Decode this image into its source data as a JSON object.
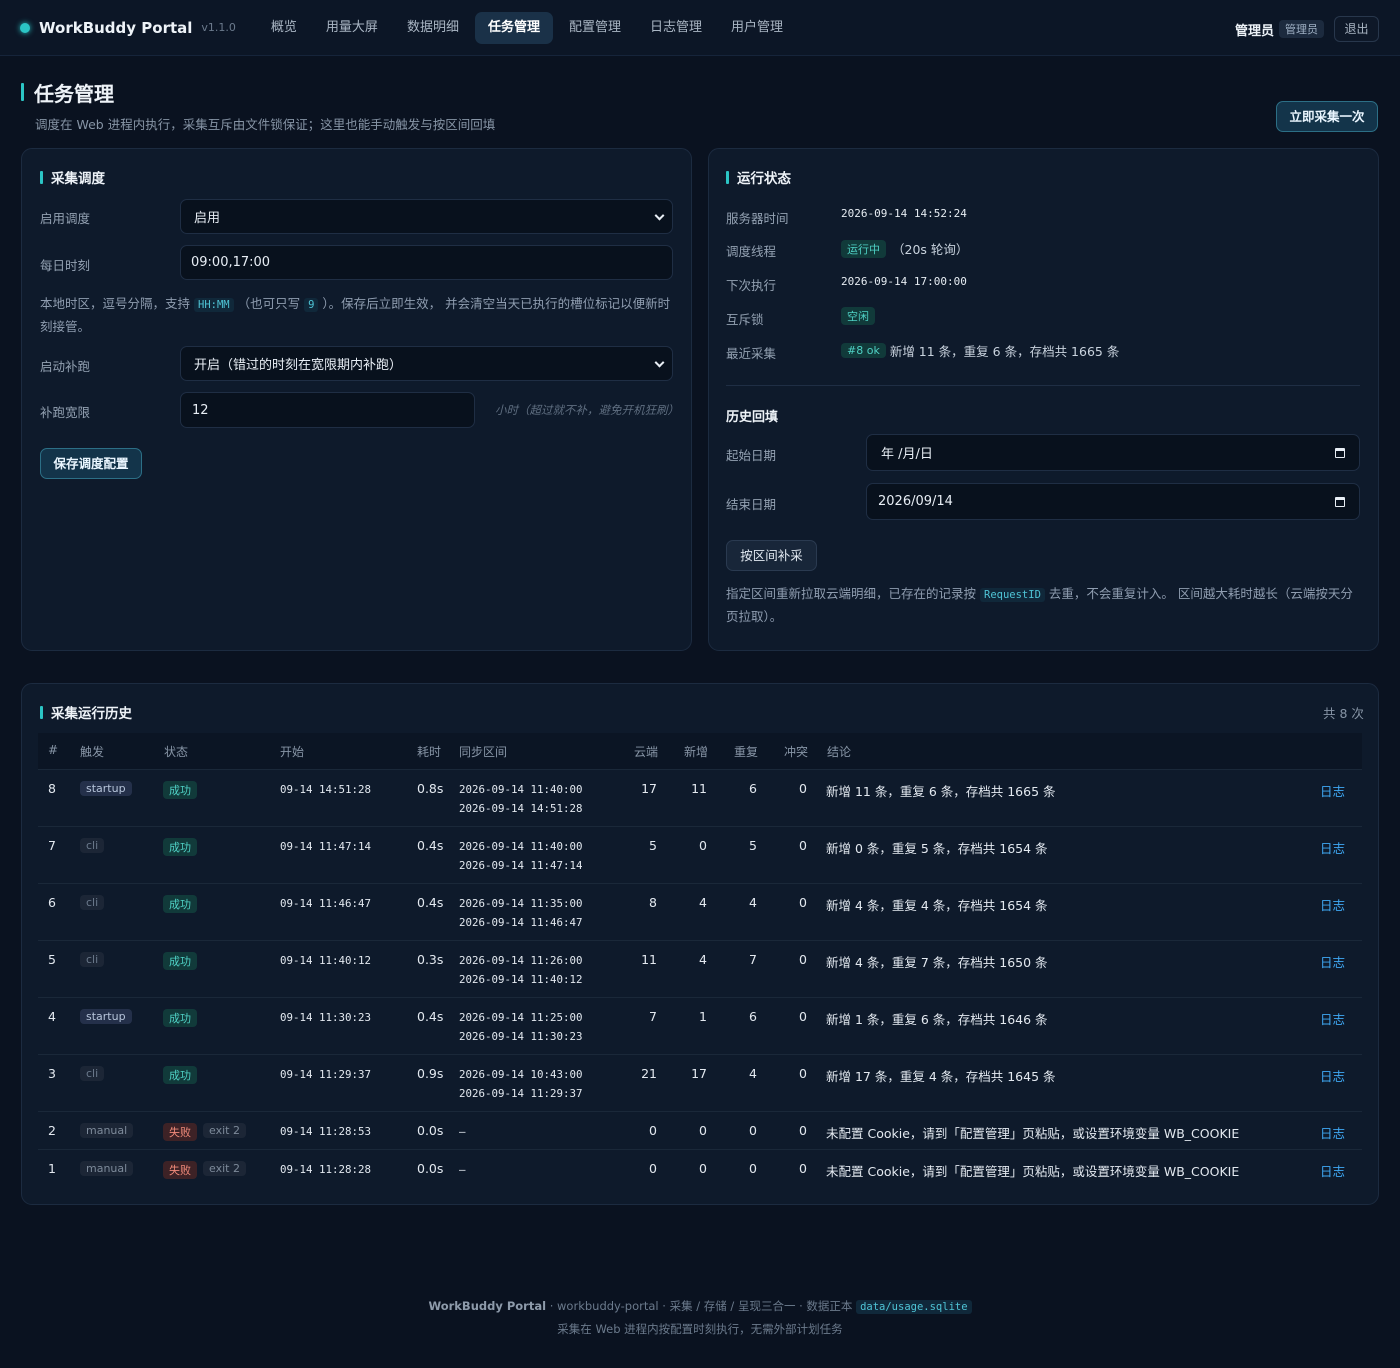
{
  "app": {
    "name": "WorkBuddy Portal",
    "version": "v1.1.0"
  },
  "nav": [
    "概览",
    "用量大屏",
    "数据明细",
    "任务管理",
    "配置管理",
    "日志管理",
    "用户管理"
  ],
  "user": {
    "name": "管理员",
    "role": "管理员",
    "logout": "退出"
  },
  "page": {
    "title": "任务管理",
    "subtitle": "调度在 Web 进程内执行，采集互斥由文件锁保证；这里也能手动触发与按区间回填",
    "collect_now": "立即采集一次"
  },
  "schedule": {
    "title": "采集调度",
    "enable_label": "启用调度",
    "enable_value": "启用",
    "times_label": "每日时刻",
    "times_value": "09:00,17:00",
    "hint_a": "本地时区，逗号分隔，支持",
    "hint_code1": "HH:MM",
    "hint_b": "（也可只写",
    "hint_code2": "9",
    "hint_c": "）。保存后立即生效， 并会清空当天已执行的槽位标记以便新时刻接管。",
    "catchup_label": "启动补跑",
    "catchup_value": "开启（错过的时刻在宽限期内补跑）",
    "grace_label": "补跑宽限",
    "grace_value": "12",
    "grace_unit": "小时（超过就不补，避免开机狂刷）",
    "save": "保存调度配置"
  },
  "status": {
    "title": "运行状态",
    "server_time_label": "服务器时间",
    "server_time": "2026-09-14 14:52:24",
    "thread_label": "调度线程",
    "thread_badge": "运行中",
    "thread_note": "（20s 轮询）",
    "next_label": "下次执行",
    "next_value": "2026-09-14 17:00:00",
    "lock_label": "互斥锁",
    "lock_badge": "空闲",
    "last_label": "最近采集",
    "last_badge": "#8 ok",
    "last_text": "新增 11 条，重复 6 条，存档共 1665 条"
  },
  "backfill": {
    "title": "历史回填",
    "start_label": "起始日期",
    "start_value": "年 /月/日",
    "end_label": "结束日期",
    "end_value": "2026/09/14",
    "button": "按区间补采",
    "hint_a": "指定区间重新拉取云端明细，已存在的记录按",
    "hint_code": "RequestID",
    "hint_b": "去重，不会重复计入。 区间越大耗时越长（云端按天分页拉取）。"
  },
  "history": {
    "title": "采集运行历史",
    "count": "共 8 次",
    "columns": [
      "#",
      "触发",
      "状态",
      "开始",
      "耗时",
      "同步区间",
      "云端",
      "新增",
      "重复",
      "冲突",
      "结论"
    ],
    "rows": [
      {
        "id": "8",
        "trigger": "startup",
        "status": "成功",
        "exit": "",
        "start": "09-14 14:51:28",
        "dur": "0.8s",
        "range1": "2026-09-14 11:40:00",
        "range2": "2026-09-14 14:51:28",
        "cloud": "17",
        "new": "11",
        "dup": "6",
        "conflict": "0",
        "result": "新增 11 条，重复 6 条，存档共 1665 条",
        "link": "日志"
      },
      {
        "id": "7",
        "trigger": "cli",
        "status": "成功",
        "exit": "",
        "start": "09-14 11:47:14",
        "dur": "0.4s",
        "range1": "2026-09-14 11:40:00",
        "range2": "2026-09-14 11:47:14",
        "cloud": "5",
        "new": "0",
        "dup": "5",
        "conflict": "0",
        "result": "新增 0 条，重复 5 条，存档共 1654 条",
        "link": "日志"
      },
      {
        "id": "6",
        "trigger": "cli",
        "status": "成功",
        "exit": "",
        "start": "09-14 11:46:47",
        "dur": "0.4s",
        "range1": "2026-09-14 11:35:00",
        "range2": "2026-09-14 11:46:47",
        "cloud": "8",
        "new": "4",
        "dup": "4",
        "conflict": "0",
        "result": "新增 4 条，重复 4 条，存档共 1654 条",
        "link": "日志"
      },
      {
        "id": "5",
        "trigger": "cli",
        "status": "成功",
        "exit": "",
        "start": "09-14 11:40:12",
        "dur": "0.3s",
        "range1": "2026-09-14 11:26:00",
        "range2": "2026-09-14 11:40:12",
        "cloud": "11",
        "new": "4",
        "dup": "7",
        "conflict": "0",
        "result": "新增 4 条，重复 7 条，存档共 1650 条",
        "link": "日志"
      },
      {
        "id": "4",
        "trigger": "startup",
        "status": "成功",
        "exit": "",
        "start": "09-14 11:30:23",
        "dur": "0.4s",
        "range1": "2026-09-14 11:25:00",
        "range2": "2026-09-14 11:30:23",
        "cloud": "7",
        "new": "1",
        "dup": "6",
        "conflict": "0",
        "result": "新增 1 条，重复 6 条，存档共 1646 条",
        "link": "日志"
      },
      {
        "id": "3",
        "trigger": "cli",
        "status": "成功",
        "exit": "",
        "start": "09-14 11:29:37",
        "dur": "0.9s",
        "range1": "2026-09-14 10:43:00",
        "range2": "2026-09-14 11:29:37",
        "cloud": "21",
        "new": "17",
        "dup": "4",
        "conflict": "0",
        "result": "新增 17 条，重复 4 条，存档共 1645 条",
        "link": "日志"
      },
      {
        "id": "2",
        "trigger": "manual",
        "status": "失败",
        "exit": "exit 2",
        "start": "09-14 11:28:53",
        "dur": "0.0s",
        "range1": "–",
        "range2": "",
        "cloud": "0",
        "new": "0",
        "dup": "0",
        "conflict": "0",
        "result": "未配置 Cookie，请到「配置管理」页粘贴，或设置环境变量 WB_COOKIE",
        "link": "日志"
      },
      {
        "id": "1",
        "trigger": "manual",
        "status": "失败",
        "exit": "exit 2",
        "start": "09-14 11:28:28",
        "dur": "0.0s",
        "range1": "–",
        "range2": "",
        "cloud": "0",
        "new": "0",
        "dup": "0",
        "conflict": "0",
        "result": "未配置 Cookie，请到「配置管理」页粘贴，或设置环境变量 WB_COOKIE",
        "link": "日志"
      }
    ]
  },
  "footer": {
    "brand": "WorkBuddy Portal",
    "text": "· workbuddy-portal · 采集 / 存储 / 呈现三合一 · 数据正本",
    "code": "data/usage.sqlite",
    "line2": "采集在 Web 进程内按配置时刻执行，无需外部计划任务"
  }
}
